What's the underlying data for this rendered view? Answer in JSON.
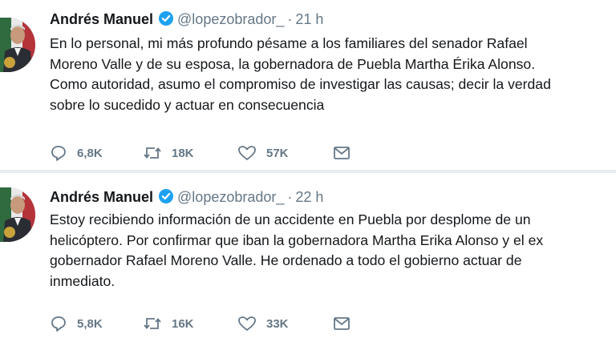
{
  "tweets": [
    {
      "author": "Andrés Manuel",
      "handle": "@lopezobrador_",
      "separator": "·",
      "time": "21 h",
      "text": "En lo personal, mi más profundo pésame a los familiares del senador Rafael\nMoreno Valle y de su esposa, la gobernadora de Puebla Martha Érika Alonso.\nComo autoridad, asumo el compromiso de investigar las causas; decir la verdad\nsobre lo sucedido y actuar en consecuencia",
      "replies": "6,8K",
      "retweets": "18K",
      "likes": "57K"
    },
    {
      "author": "Andrés Manuel",
      "handle": "@lopezobrador_",
      "separator": "·",
      "time": "22 h",
      "text": "Estoy recibiendo información de un accidente en Puebla por desplome de un\nhelicóptero. Por confirmar que iban la gobernadora Martha Erika Alonso y el ex\ngobernador Rafael Moreno Valle. He ordenado a todo el gobierno actuar de\ninmediato.",
      "replies": "5,8K",
      "retweets": "16K",
      "likes": "33K"
    }
  ],
  "colors": {
    "text": "#14171a",
    "muted": "#657786",
    "verified": "#1da1f2",
    "divider": "#e6ecf0"
  },
  "icons": [
    "reply-icon",
    "retweet-icon",
    "like-icon",
    "direct-message-icon",
    "verified-badge-icon"
  ]
}
